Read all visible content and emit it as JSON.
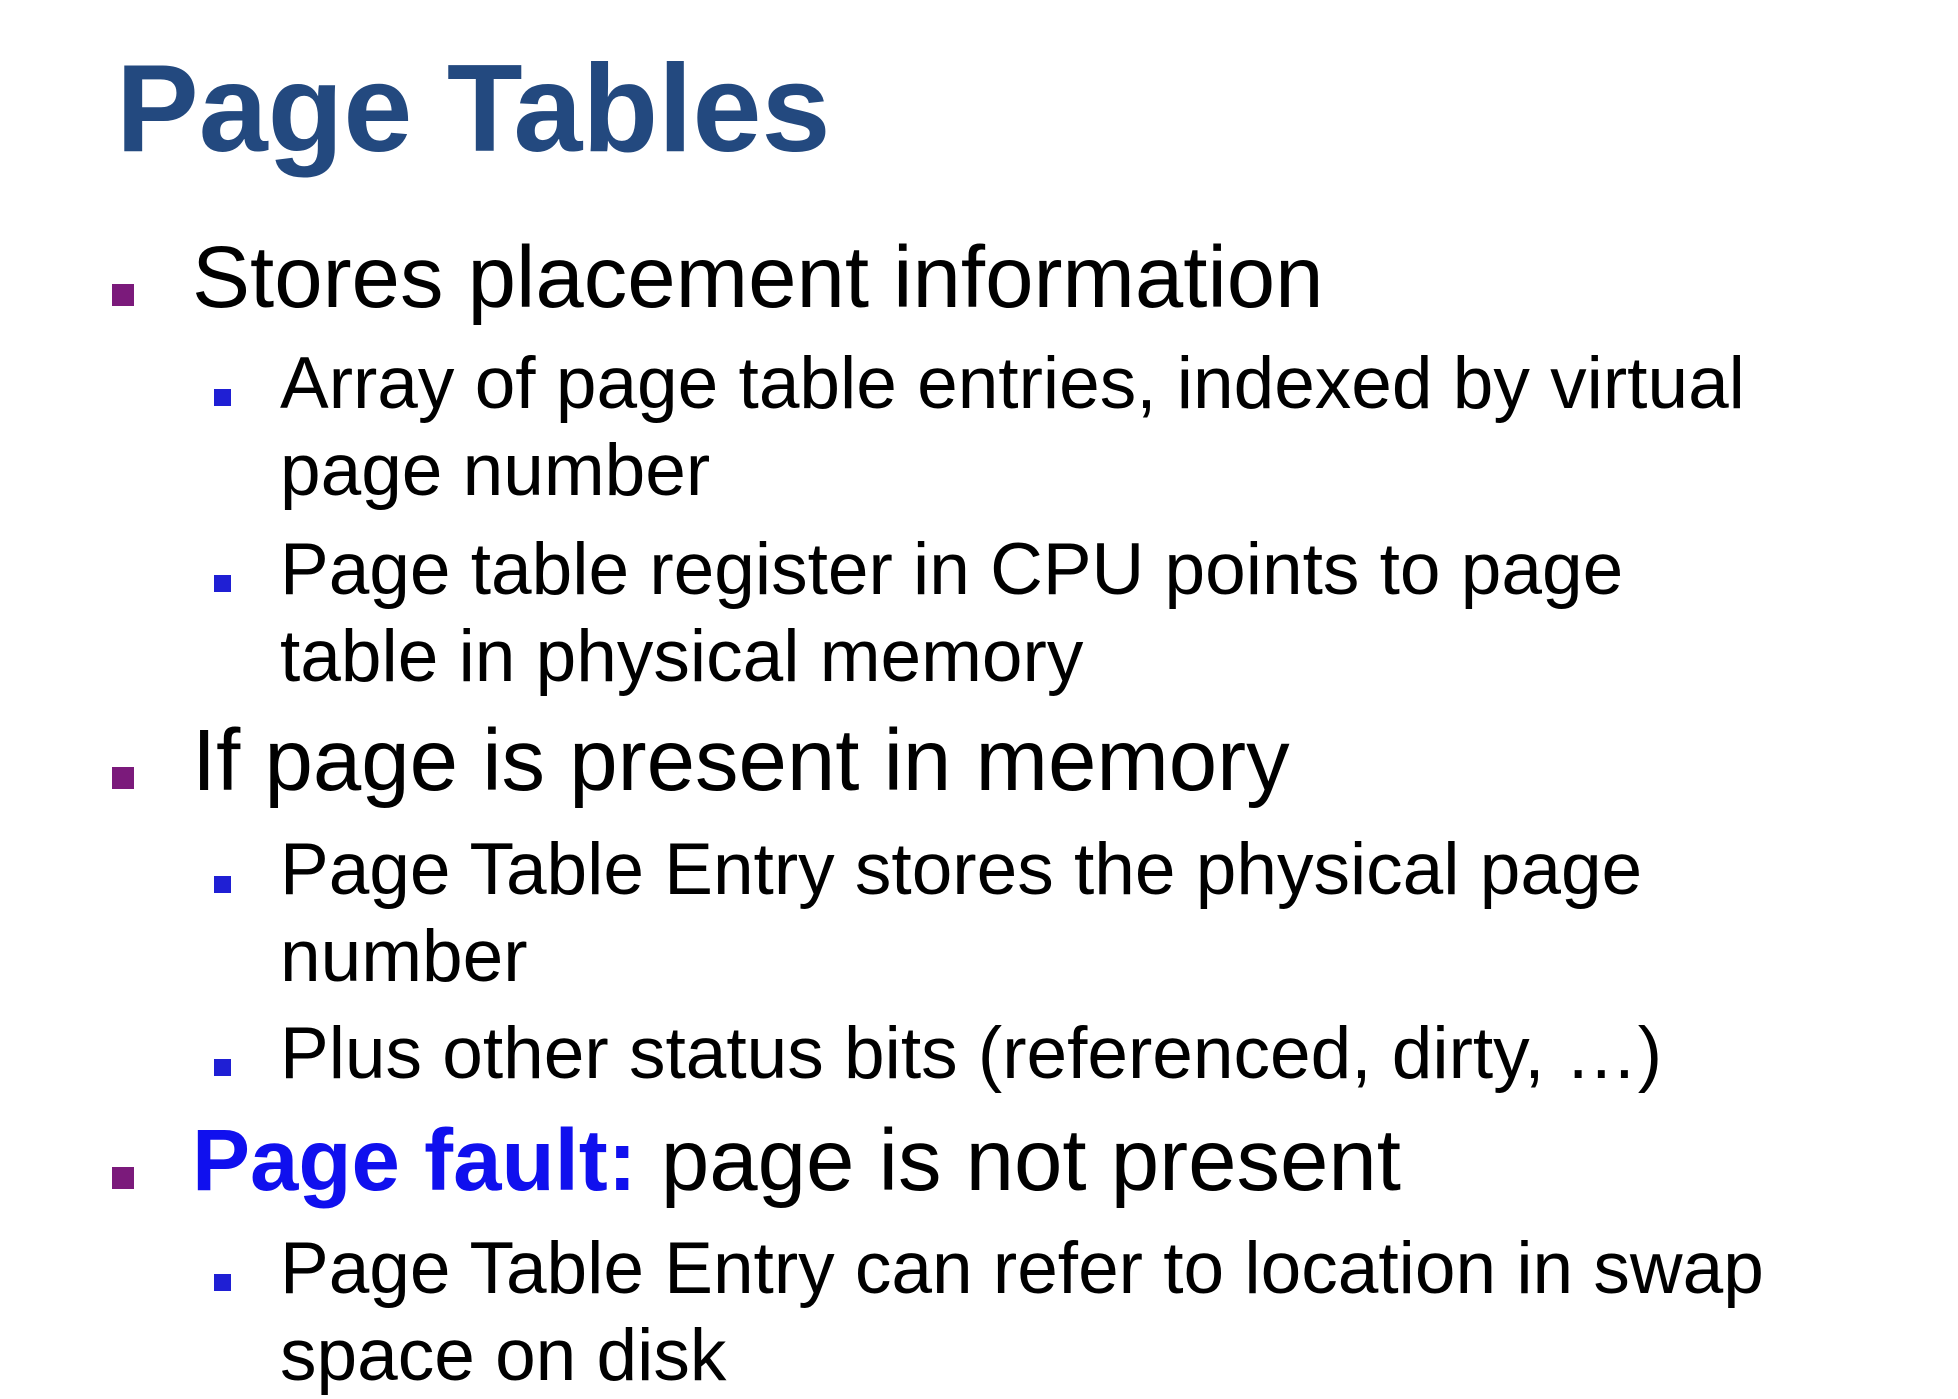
{
  "slide": {
    "title": "Page Tables",
    "colors": {
      "title": "#23497f",
      "level1_bullet": "#7b1a7b",
      "level2_bullet": "#1f1fd4",
      "emphasis": "#1010ee",
      "text": "#000000"
    },
    "bullets": [
      {
        "level": 1,
        "lines": [
          "Stores placement information"
        ]
      },
      {
        "level": 2,
        "lines": [
          "Array of page table entries, indexed by virtual",
          "page number"
        ]
      },
      {
        "level": 2,
        "lines": [
          "Page table register in CPU points to page",
          "table in physical memory"
        ]
      },
      {
        "level": 1,
        "lines": [
          "If page is present in memory"
        ]
      },
      {
        "level": 2,
        "lines": [
          "Page Table Entry stores the physical page",
          "number"
        ]
      },
      {
        "level": 2,
        "lines": [
          "Plus other status bits (referenced, dirty, …)"
        ]
      },
      {
        "level": 1,
        "emphasis": "Page fault:",
        "lines": [
          " page is not present"
        ]
      },
      {
        "level": 2,
        "lines": [
          "Page Table Entry can refer to location in swap",
          "space on disk"
        ]
      }
    ]
  }
}
